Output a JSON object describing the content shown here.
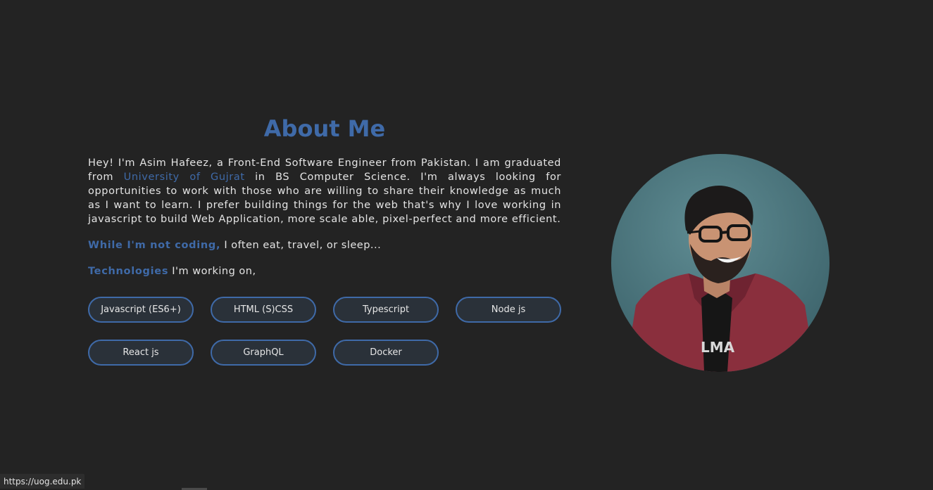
{
  "about": {
    "title": "About Me",
    "bio_before_link": "Hey! I'm Asim Hafeez, a Front-End Software Engineer from Pakistan. I am graduated from ",
    "bio_link": "University of Gujrat",
    "bio_after_link": " in BS Computer Science. I'm always looking for opportunities to work with those who are willing to share their knowledge as much as I want to learn. I prefer building things for the web that's why I love working in javascript to build Web Application, more scale able, pixel-perfect and more efficient.",
    "hobby_highlight": "While I'm not coding,",
    "hobby_text": " I often eat, travel, or sleep...",
    "tech_highlight": "Technologies",
    "tech_text": " I'm working on,"
  },
  "technologies": [
    "Javascript (ES6+)",
    "HTML (S)CSS",
    "Typescript",
    "Node js",
    "React js",
    "GraphQL",
    "Docker"
  ],
  "profile_image": "portrait-photo",
  "status_bar": {
    "url": "https://uog.edu.pk"
  },
  "colors": {
    "background": "#232323",
    "accent": "#3f6aa8",
    "chip_background": "#2a3139",
    "text": "#e4e4e4"
  }
}
